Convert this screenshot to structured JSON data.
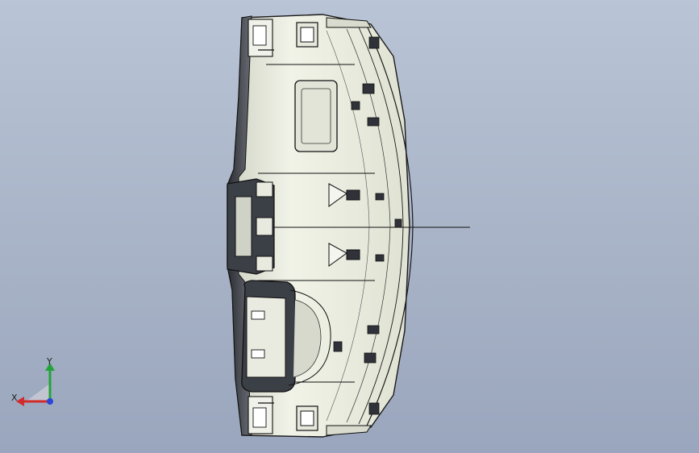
{
  "viewport": {
    "background_top": "#b9c4d6",
    "background_bottom": "#9aa6bd"
  },
  "model": {
    "body_color": "#e9ecdf",
    "edge_color": "#1a1a1a",
    "shadow_color": "#3a3d45"
  },
  "triad": {
    "x_label": "X",
    "y_label": "Y",
    "x_color": "#d22b2b",
    "y_color": "#22a43a",
    "z_color": "#2a45d8"
  }
}
